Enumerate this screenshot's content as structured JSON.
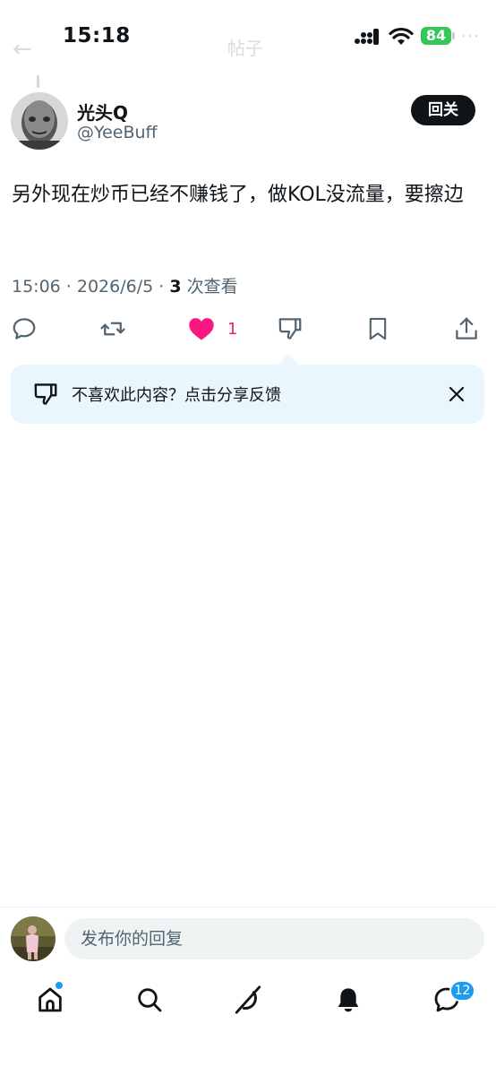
{
  "status_bar": {
    "time": "15:18",
    "battery": "84",
    "header_title": "帖子"
  },
  "colors": {
    "like_pink": "#f91880",
    "accent_blue": "#1d9bf0",
    "battery_green": "#34c759",
    "banner_bg": "#e9f6fd",
    "secondary_text": "#536471"
  },
  "tweet": {
    "author_name": "光头Q",
    "author_handle": "@YeeBuff",
    "follow_back_label": "回关",
    "text": "另外现在炒币已经不赚钱了，做KOL没流量，要擦边",
    "time_date": "15:06 · 2026/6/5 · ",
    "view_count": "3",
    "views_label": " 次查看",
    "like_count": "1"
  },
  "actions": {
    "icons": [
      "reply-icon",
      "retweet-icon",
      "heart-icon",
      "dislike-icon",
      "bookmark-icon",
      "share-icon"
    ]
  },
  "feedback": {
    "text": "不喜欢此内容？点击分享反馈",
    "icon": "dislike-icon",
    "close_icon": "close-icon"
  },
  "reply": {
    "placeholder": "发布你的回复"
  },
  "tab_bar": {
    "icons": [
      "home-icon",
      "search-icon",
      "grok-icon",
      "bell-icon",
      "messages-icon"
    ],
    "messages_badge": "12"
  }
}
